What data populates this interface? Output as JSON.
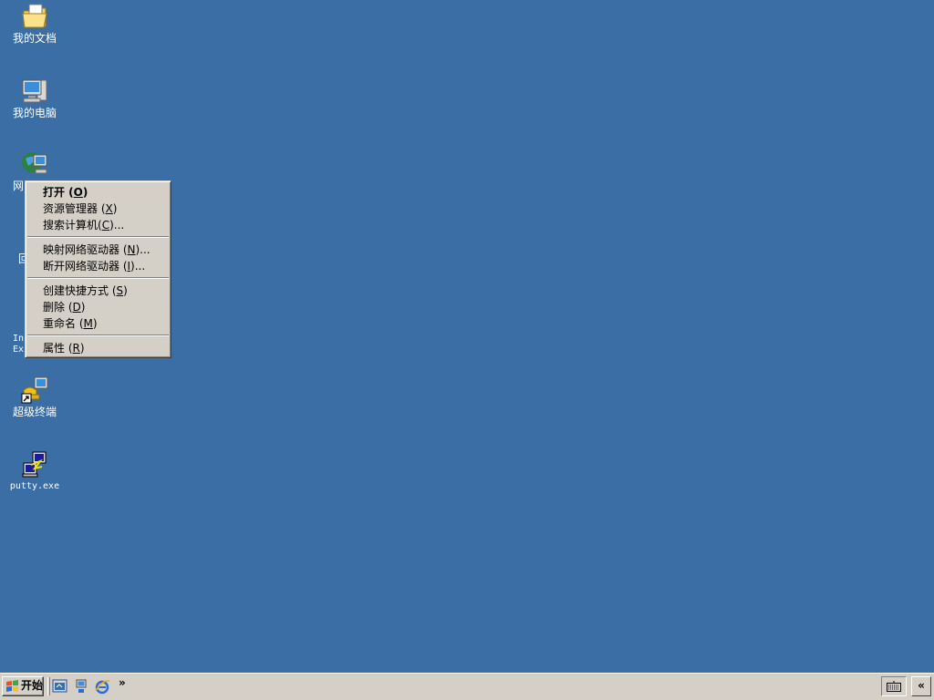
{
  "desktop": {
    "background_color": "#3a6ea5",
    "icons": [
      {
        "label": "我的文档",
        "icon": "folder-documents-icon"
      },
      {
        "label": "我的电脑",
        "icon": "my-computer-icon"
      },
      {
        "label": "网",
        "icon": "network-places-icon"
      },
      {
        "label": "回",
        "icon": "recycle-bin-icon"
      },
      {
        "label_line1": "In",
        "label_line2": "Ex",
        "icon": "internet-explorer-icon"
      },
      {
        "label": "超级终端",
        "icon": "hyperterminal-shortcut-icon"
      },
      {
        "label": "putty.exe",
        "icon": "putty-icon"
      }
    ]
  },
  "context_menu": {
    "items": [
      {
        "text": "打开 (",
        "accel": "O",
        "tail": ")",
        "default": true
      },
      {
        "text": "资源管理器 (",
        "accel": "X",
        "tail": ")"
      },
      {
        "text": "搜索计算机(",
        "accel": "C",
        "tail": ")..."
      },
      {
        "separator": true
      },
      {
        "text": "映射网络驱动器 (",
        "accel": "N",
        "tail": ")..."
      },
      {
        "text": "断开网络驱动器 (",
        "accel": "I",
        "tail": ")..."
      },
      {
        "separator": true
      },
      {
        "text": "创建快捷方式 (",
        "accel": "S",
        "tail": ")"
      },
      {
        "text": "删除 (",
        "accel": "D",
        "tail": ")"
      },
      {
        "text": "重命名 (",
        "accel": "M",
        "tail": ")"
      },
      {
        "separator": true
      },
      {
        "text": "属性 (",
        "accel": "R",
        "tail": ")"
      }
    ]
  },
  "taskbar": {
    "start_label": "开始",
    "quick_launch": [
      "show-desktop-icon",
      "network-icon",
      "internet-explorer-icon"
    ],
    "more_chevron": "»",
    "tray_icon": "keyboard-icon",
    "tray_toggle": "«"
  }
}
